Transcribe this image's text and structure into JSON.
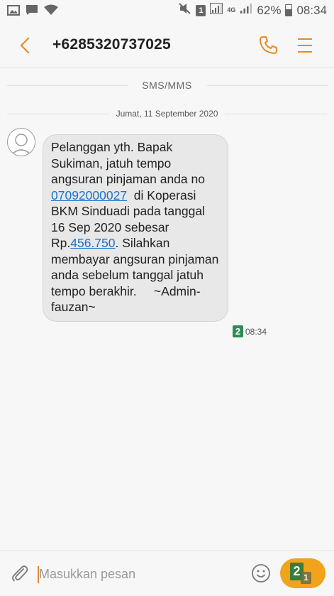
{
  "status_bar": {
    "sim_number": "1",
    "network_type": "4G",
    "battery_percent": "62%",
    "time": "08:34"
  },
  "header": {
    "title": "+6285320737025"
  },
  "conversation": {
    "section_label": "SMS/MMS",
    "date": "Jumat, 11 September 2020",
    "message": {
      "text_part1": "Pelanggan yth. Bapak Sukiman, jatuh tempo angsuran pinjaman anda no ",
      "link_number": "07092000027",
      "text_part2": "  di Koperasi BKM Sinduadi pada tanggal 16 Sep 2020 sebesar Rp.",
      "link_amount": "456.750",
      "text_part3": ". Silahkan membayar angsuran pinjaman anda sebelum tanggal jatuh tempo berakhir.     ~Admin-fauzan~",
      "sim": "2",
      "time": "08:34"
    }
  },
  "composer": {
    "placeholder": "Masukkan pesan",
    "send_sim_primary": "2",
    "send_sim_secondary": "1"
  },
  "colors": {
    "accent": "#e8892b",
    "send_button": "#f0a31b",
    "link": "#1a73c8",
    "sim2_badge": "#2e8b57"
  }
}
